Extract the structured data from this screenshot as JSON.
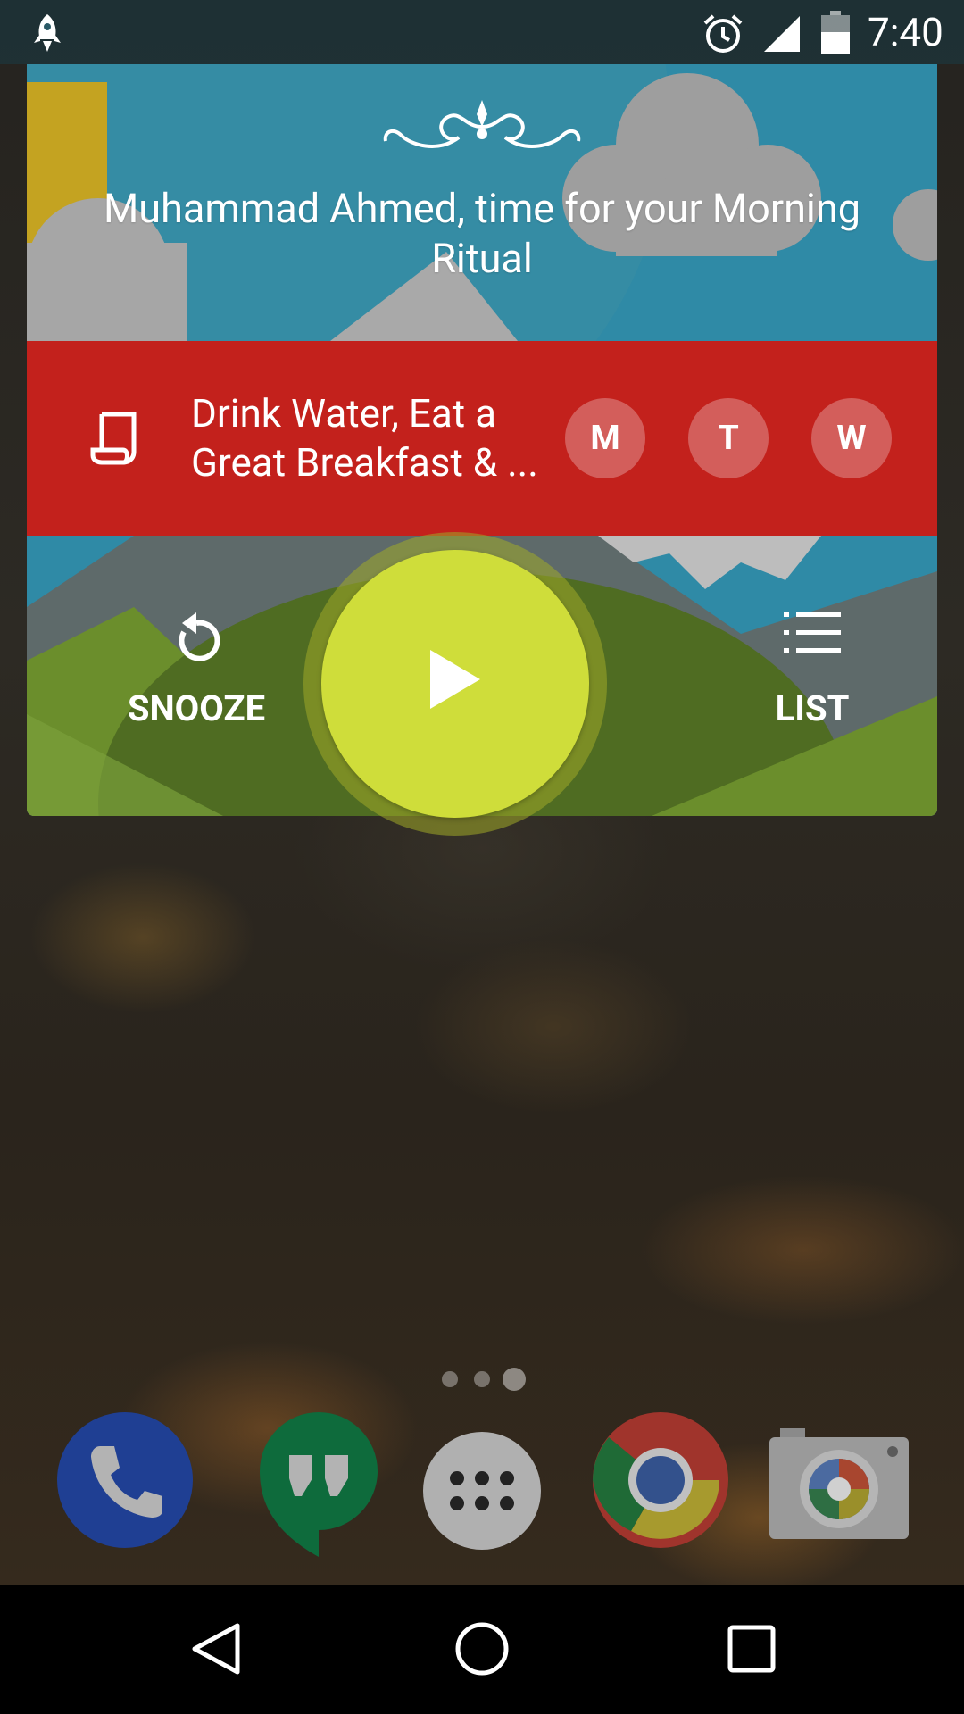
{
  "status_bar": {
    "time": "7:40",
    "icons": [
      "rocket-icon",
      "alarm-icon",
      "signal-icon",
      "battery-icon"
    ]
  },
  "widget": {
    "title": "Muhammad Ahmed, time for your Morning Ritual",
    "habit": {
      "line1": "Drink Water, Eat a",
      "line2": "Great Breakfast & ...",
      "icon": "scroll-icon"
    },
    "days": [
      "M",
      "T",
      "W"
    ],
    "snooze_label": "SNOOZE",
    "list_label": "LIST",
    "play_icon": "play-icon",
    "colors": {
      "habit_bar": "#c3211c",
      "play_button": "#cfdd3a",
      "sky": "#2f8aa6"
    }
  },
  "home": {
    "page_count": 3,
    "current_page": 3,
    "dock": [
      "phone-icon",
      "hangouts-icon",
      "app-drawer-icon",
      "chrome-icon",
      "camera-icon"
    ]
  },
  "navigation": [
    "back-icon",
    "home-icon",
    "recents-icon"
  ]
}
